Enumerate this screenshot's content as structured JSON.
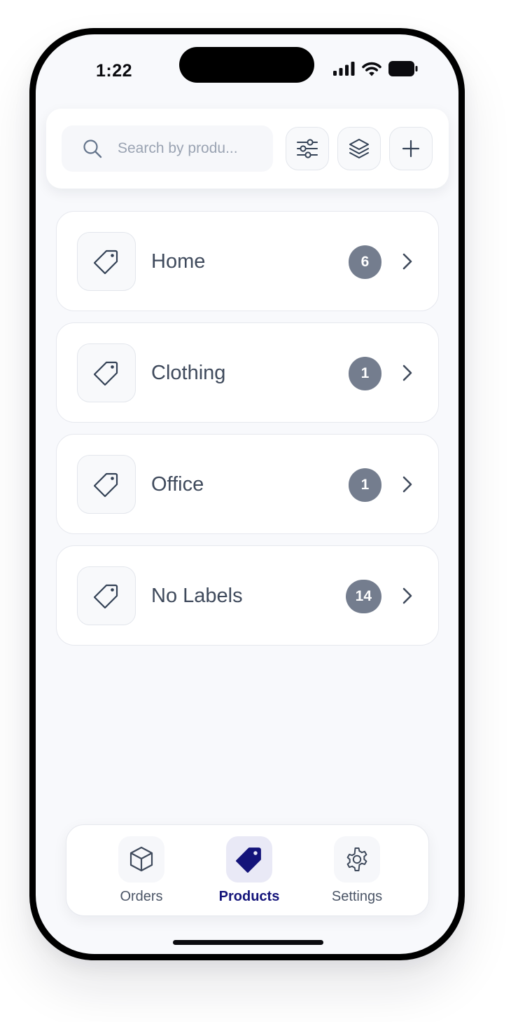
{
  "status_bar": {
    "time": "1:22"
  },
  "search": {
    "placeholder": "Search by produ...",
    "value": ""
  },
  "toolbar": {
    "filter_icon": "sliders-icon",
    "layers_icon": "layers-icon",
    "add_icon": "plus-icon"
  },
  "categories": [
    {
      "label": "Home",
      "count": "6"
    },
    {
      "label": "Clothing",
      "count": "1"
    },
    {
      "label": "Office",
      "count": "1"
    },
    {
      "label": "No Labels",
      "count": "14"
    }
  ],
  "tabbar": {
    "tabs": [
      {
        "label": "Orders",
        "icon": "box-icon",
        "active": false
      },
      {
        "label": "Products",
        "icon": "tag-icon",
        "active": true
      },
      {
        "label": "Settings",
        "icon": "gear-icon",
        "active": false
      }
    ]
  },
  "colors": {
    "accent": "#14147a",
    "badge": "#747d8e",
    "background": "#f8f9fc"
  }
}
